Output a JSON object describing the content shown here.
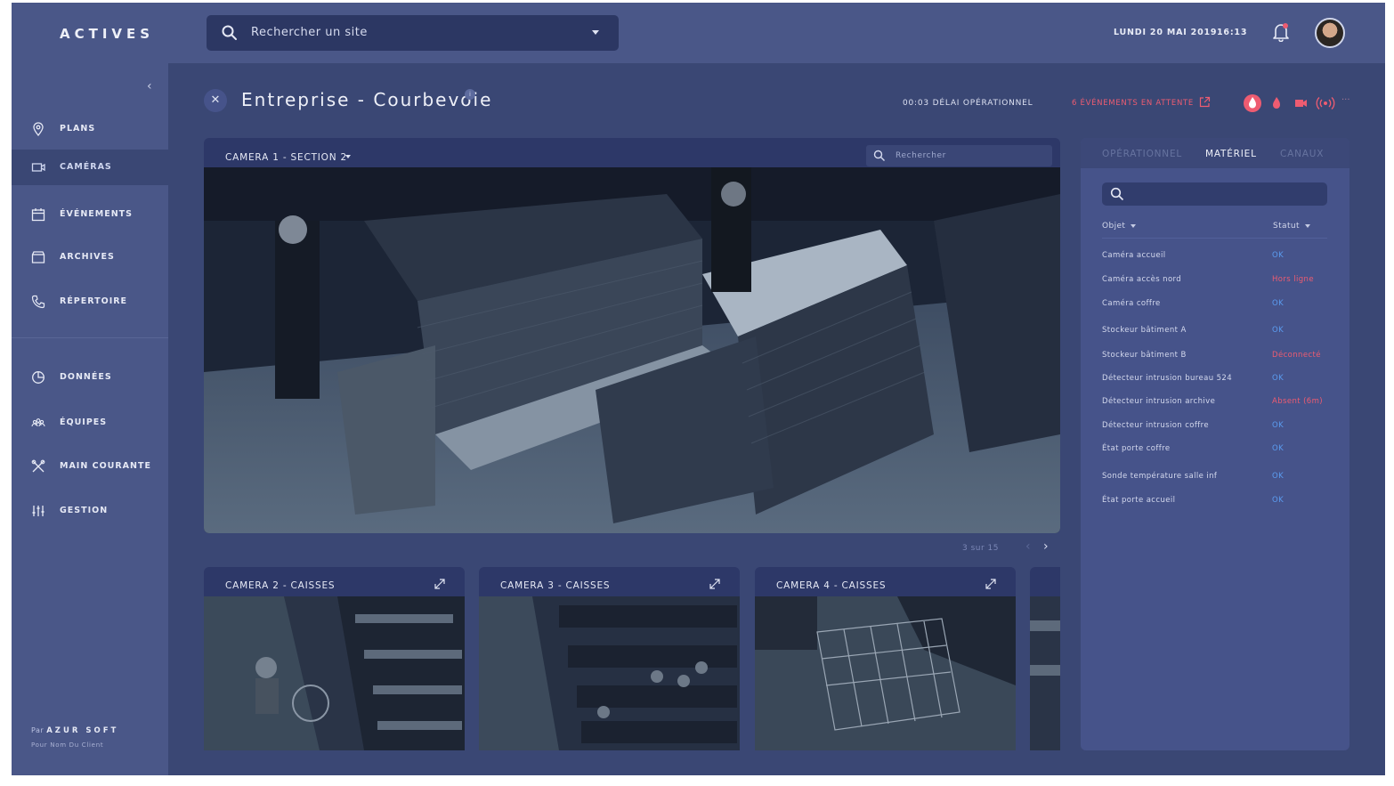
{
  "app": {
    "logo": "ACTIVES",
    "search_placeholder": "Rechercher un site",
    "date": "LUNDI 20 MAI 2019",
    "time": "16:13"
  },
  "sidebar": {
    "items": [
      {
        "label": "PLANS",
        "icon": "map-pin-icon"
      },
      {
        "label": "CAMÉRAS",
        "icon": "camera-icon",
        "active": true
      },
      {
        "label": "ÉVÉNEMENTS",
        "icon": "calendar-icon"
      },
      {
        "label": "ARCHIVES",
        "icon": "archive-box-icon"
      },
      {
        "label": "RÉPERTOIRE",
        "icon": "phone-icon"
      },
      {
        "label": "DONNÉES",
        "icon": "pie-chart-icon"
      },
      {
        "label": "ÉQUIPES",
        "icon": "team-icon"
      },
      {
        "label": "MAIN COURANTE",
        "icon": "tools-icon"
      },
      {
        "label": "GESTION",
        "icon": "sliders-icon"
      }
    ],
    "brand_prefix": "Par",
    "brand_name": "AZUR SOFT",
    "brand_sub": "Pour Nom Du Client"
  },
  "header": {
    "title": "Entreprise - Courbevoie",
    "info": "i",
    "delay": "00:03 DÉLAI OPÉRATIONNEL",
    "events": "6 ÉVÉNEMENTS EN ATTENTE",
    "dots": "···"
  },
  "main_camera": {
    "label": "CAMERA 1 - SECTION 2",
    "search_placeholder": "Rechercher"
  },
  "pager": {
    "text": "3 sur 15"
  },
  "thumbnails": [
    {
      "label": "CAMERA 2 - CAISSES"
    },
    {
      "label": "CAMERA 3 - CAISSES"
    },
    {
      "label": "CAMERA 4 - CAISSES"
    }
  ],
  "panel": {
    "tabs": [
      "OPÉRATIONNEL",
      "MATÉRIEL",
      "CANAUX"
    ],
    "active_tab": "MATÉRIEL",
    "col_object": "Objet",
    "col_status": "Statut",
    "rows": [
      {
        "name": "Caméra accueil",
        "status": "OK",
        "alert": false
      },
      {
        "name": "Caméra accès nord",
        "status": "Hors ligne",
        "alert": true
      },
      {
        "name": "Caméra coffre",
        "status": "OK",
        "alert": false
      },
      {
        "name": "Stockeur bâtiment A",
        "status": "OK",
        "alert": false
      },
      {
        "name": "Stockeur bâtiment B",
        "status": "Déconnecté",
        "alert": true
      },
      {
        "name": "Détecteur intrusion bureau 524",
        "status": "OK",
        "alert": false
      },
      {
        "name": "Détecteur intrusion archive",
        "status": "Absent (6m)",
        "alert": true
      },
      {
        "name": "Détecteur intrusion coffre",
        "status": "OK",
        "alert": false
      },
      {
        "name": "État porte coffre",
        "status": "OK",
        "alert": false
      },
      {
        "name": "Sonde température salle inf",
        "status": "OK",
        "alert": false
      },
      {
        "name": "État porte accueil",
        "status": "OK",
        "alert": false
      }
    ]
  },
  "colors": {
    "background": "#3a4774",
    "sidebar": "#4a5788",
    "alert": "#ee5c71",
    "ok": "#5b9cf0"
  }
}
